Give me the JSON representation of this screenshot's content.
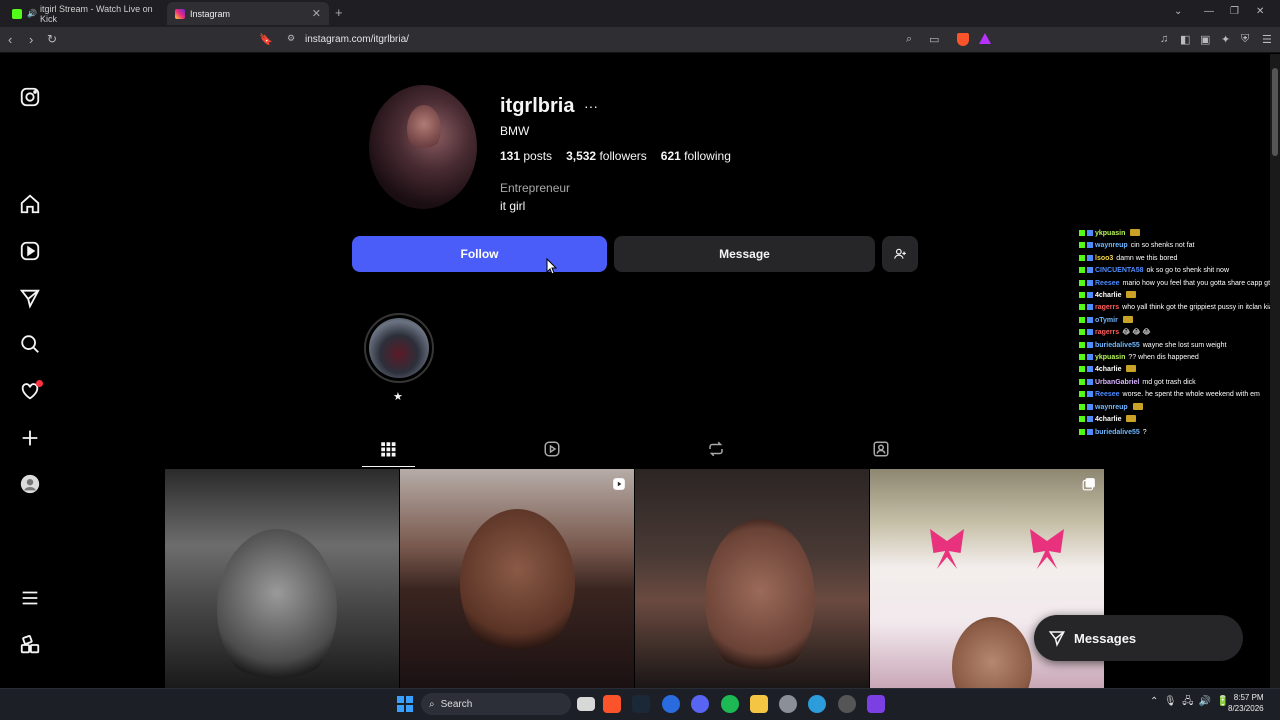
{
  "browser": {
    "tabs": [
      {
        "label": "itgirl Stream - Watch Live on Kick",
        "favicon_color": "#53fc18"
      },
      {
        "label": "Instagram",
        "favicon_color": "#e1306c"
      }
    ],
    "url": "instagram.com/itgrlbria/"
  },
  "profile": {
    "username": "itgrlbria",
    "full_name": "BMW",
    "stats": {
      "posts_count": "131",
      "posts_label": "posts",
      "followers_count": "3,532",
      "followers_label": "followers",
      "following_count": "621",
      "following_label": "following"
    },
    "category": "Entrepreneur",
    "bio": "it girl",
    "follow_label": "Follow",
    "message_label": "Message",
    "highlight_label": "★"
  },
  "messages_label": "Messages",
  "chat": [
    {
      "user": "ykpuasin",
      "color": "#b7f55a",
      "text": "",
      "emote": true
    },
    {
      "user": "waynreup",
      "color": "#6fb8ff",
      "text": "cin so shenks not fat"
    },
    {
      "user": "lsoo3",
      "color": "#f7d94a",
      "text": "damn we this bored"
    },
    {
      "user": "CINCUENTA58",
      "color": "#4e8cff",
      "text": "ok so go to shenk shit now"
    },
    {
      "user": "Reesee",
      "color": "#4e8cff",
      "text": "mario how you feel that you gotta share capp gta hoes and now md"
    },
    {
      "user": "4charlie",
      "color": "#ffffff",
      "text": "",
      "emote": true
    },
    {
      "user": "ragerrs",
      "color": "#ff5d5d",
      "text": "who yall think got the grippiest pussy in itclan kiah or barbie"
    },
    {
      "user": "oTymir",
      "color": "#6fb8ff",
      "text": "",
      "emote": true
    },
    {
      "user": "ragerrs",
      "color": "#ff5d5d",
      "text": "😂 😂 😂"
    },
    {
      "user": "buriedalive55",
      "color": "#6fb8ff",
      "text": "wayne she lost sum weight"
    },
    {
      "user": "ykpuasin",
      "color": "#b7f55a",
      "text": "?? when dis happened"
    },
    {
      "user": "4charlie",
      "color": "#ffffff",
      "text": "",
      "emote": true
    },
    {
      "user": "UrbanGabriel",
      "color": "#d9b3ff",
      "text": "md got trash dick"
    },
    {
      "user": "Reesee",
      "color": "#4e8cff",
      "text": "worse. he spent the whole weekend with em"
    },
    {
      "user": "waynreup",
      "color": "#6fb8ff",
      "text": "",
      "emote": true
    },
    {
      "user": "4charlie",
      "color": "#ffffff",
      "text": "",
      "emote": true
    },
    {
      "user": "buriedalive55",
      "color": "#6fb8ff",
      "text": "?"
    }
  ],
  "taskbar": {
    "search_placeholder": "Search",
    "time": "8:57 PM",
    "date": "8/23/2026"
  },
  "icons": {
    "sidebar": [
      "instagram-logo-icon",
      "home-icon",
      "reels-icon",
      "explore-icon",
      "search-icon",
      "heart-icon",
      "create-icon",
      "profile-icon",
      "menu-icon",
      "more-apps-icon"
    ],
    "profile_tabs": [
      "posts-grid-icon",
      "reels-tab-icon",
      "reposts-tab-icon",
      "tagged-tab-icon"
    ]
  },
  "colors": {
    "follow_button": "#4a5df9",
    "secondary_button": "#262628",
    "background": "#000000",
    "notification_dot": "#ff3040"
  }
}
